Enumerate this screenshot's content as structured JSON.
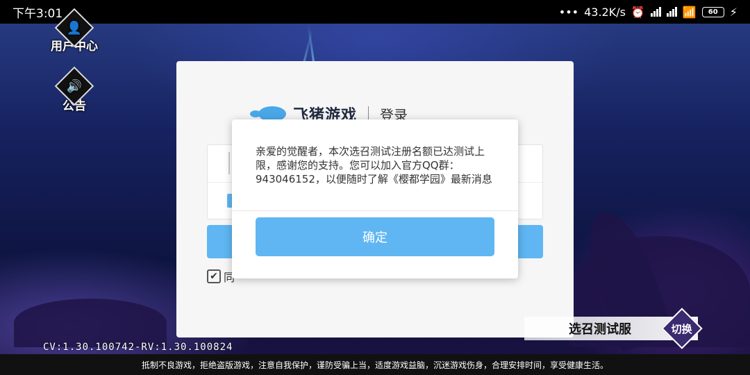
{
  "status_bar": {
    "time": "下午3:01",
    "network_speed": "43.2K/s",
    "battery": "60"
  },
  "side": {
    "user_center_label": "用户中心",
    "notice_label": "公告"
  },
  "login_panel": {
    "brand": "飞猪游戏",
    "title": "登录",
    "agree_text": "同"
  },
  "dialog": {
    "message": "亲爱的觉醒者，本次选召测试注册名额已达测试上限，感谢您的支持。您可以加入官方QQ群：943046152，以便随时了解《樱都学园》最新消息",
    "confirm_label": "确定"
  },
  "server": {
    "name": "选召测试服",
    "switch_label": "切换"
  },
  "version": "CV:1.30.100742-RV:1.30.100824",
  "footer_notice": "抵制不良游戏，拒绝盗版游戏，注意自我保护，谨防受骗上当，适度游戏益脑，沉迷游戏伤身，合理安排时间，享受健康生活。"
}
